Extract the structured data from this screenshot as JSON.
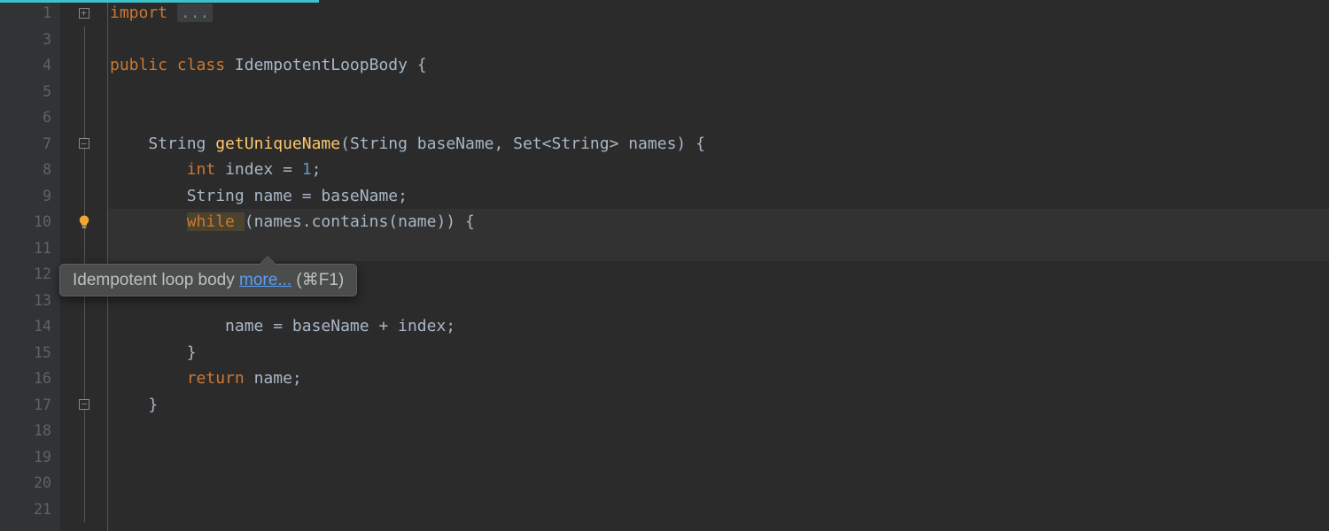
{
  "progress_width": 360,
  "lines": [
    1,
    3,
    4,
    5,
    6,
    7,
    8,
    9,
    10,
    11,
    12,
    13,
    14,
    15,
    16,
    17,
    18,
    19,
    20,
    21
  ],
  "code": {
    "l1": {
      "kw": "import ",
      "folded": "..."
    },
    "l4": {
      "kw1": "public ",
      "kw2": "class ",
      "cls": "IdempotentLoopBody ",
      "brace": "{"
    },
    "l7": {
      "type": "String ",
      "meth": "getUniqueName",
      "sig": "(String baseName, Set<String> names) {"
    },
    "l8": {
      "kw": "int ",
      "var": "index = ",
      "num": "1",
      "semi": ";"
    },
    "l9": {
      "type": "String name = baseName;"
    },
    "l10": {
      "kw": "while ",
      "rest": "(names.contains(name)) {"
    },
    "l14": {
      "text": "name = baseName + index;"
    },
    "l15": {
      "text": "}"
    },
    "l16": {
      "kw": "return ",
      "rest": "name;"
    },
    "l17": {
      "text": "}"
    }
  },
  "tooltip": {
    "text": "Idempotent loop body ",
    "link": "more...",
    "shortcut": " (⌘F1)"
  },
  "icons": {
    "bulb": "lightbulb-icon"
  }
}
